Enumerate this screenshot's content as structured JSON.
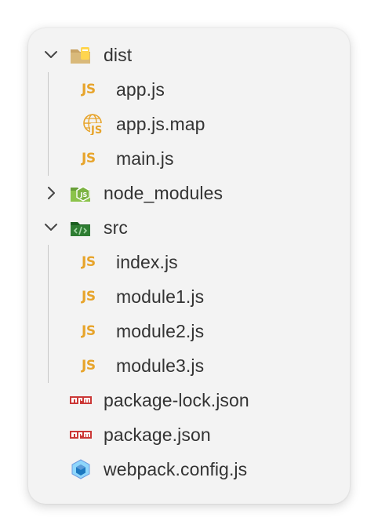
{
  "explorer": {
    "items": [
      {
        "label": "dist",
        "level": 0,
        "kind": "folder",
        "expanded": true,
        "icon": "dist-folder-icon"
      },
      {
        "label": "app.js",
        "level": 1,
        "kind": "file",
        "icon": "javascript-file-icon"
      },
      {
        "label": "app.js.map",
        "level": 1,
        "kind": "file",
        "icon": "javascript-map-file-icon"
      },
      {
        "label": "main.js",
        "level": 1,
        "kind": "file",
        "icon": "javascript-file-icon"
      },
      {
        "label": "node_modules",
        "level": 0,
        "kind": "folder",
        "expanded": false,
        "icon": "node-folder-icon"
      },
      {
        "label": "src",
        "level": 0,
        "kind": "folder",
        "expanded": true,
        "icon": "src-folder-icon"
      },
      {
        "label": "index.js",
        "level": 1,
        "kind": "file",
        "icon": "javascript-file-icon"
      },
      {
        "label": "module1.js",
        "level": 1,
        "kind": "file",
        "icon": "javascript-file-icon"
      },
      {
        "label": "module2.js",
        "level": 1,
        "kind": "file",
        "icon": "javascript-file-icon"
      },
      {
        "label": "module3.js",
        "level": 1,
        "kind": "file",
        "icon": "javascript-file-icon"
      },
      {
        "label": "package-lock.json",
        "level": 0,
        "kind": "file",
        "icon": "npm-icon"
      },
      {
        "label": "package.json",
        "level": 0,
        "kind": "file",
        "icon": "npm-icon"
      },
      {
        "label": "webpack.config.js",
        "level": 0,
        "kind": "file",
        "icon": "webpack-icon"
      }
    ],
    "js_glyph": "JS",
    "colors": {
      "panel_background": "#f3f3f3",
      "text": "#333333",
      "javascript": "#e7a42b",
      "node_green": "#7cb342",
      "src_green": "#2e7d32",
      "npm_red": "#cb3837",
      "webpack_blue": "#6f9be0"
    }
  }
}
